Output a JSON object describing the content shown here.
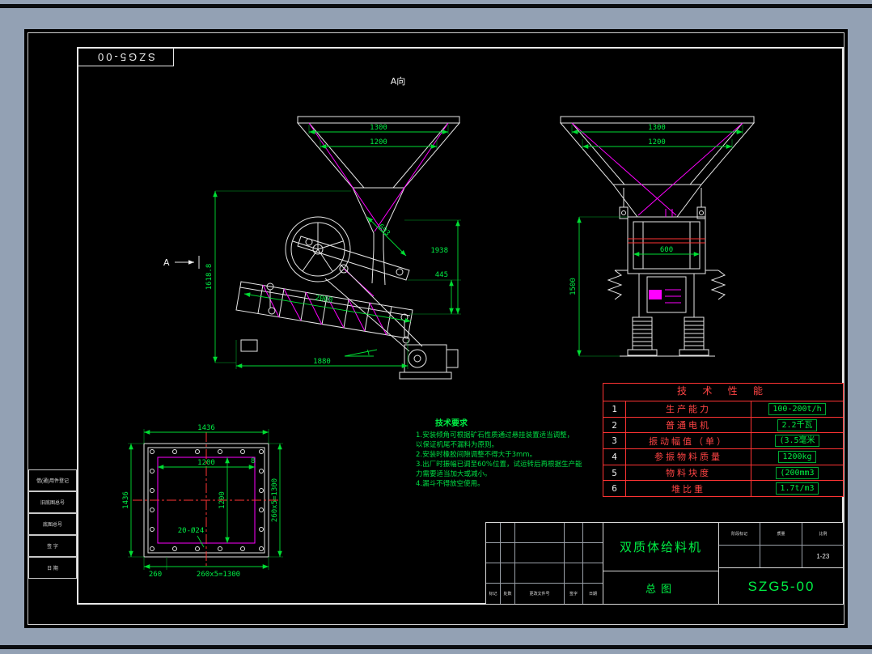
{
  "corner": {
    "drawing_no": "SZG5-00"
  },
  "labels": {
    "a_dir": "A向",
    "a_arrow": "A"
  },
  "front": {
    "dim_1300": "1300",
    "dim_1200": "1200",
    "dim_1618": "1618.8",
    "dim_1938": "1938",
    "dim_445": "445",
    "dim_693": "693",
    "dim_2000": "2000",
    "dim_1880": "1880"
  },
  "side": {
    "dim_1300": "1300",
    "dim_1200": "1200",
    "dim_1500": "1500",
    "dim_600": "600"
  },
  "plan": {
    "dim_top": "1436",
    "dim_left": "1436",
    "dim_1200h": "1200",
    "dim_1200v": "1200",
    "dim_8": "8",
    "dim_right": "260x5=1300",
    "dim_bottom": "260x5=1300",
    "dim_260": "260",
    "holes": "20-Ø24"
  },
  "notes": {
    "title": "技术要求",
    "lines": [
      "1.安装倾角可根据矿石性质通过悬挂装置适当调整，",
      "  以保证机尾不漏料为原则。",
      "2.安装时橡胶间隙调整不得大于3mm。",
      "3.出厂时振幅已调至60%位置，试运转后再根据生产能",
      "  力需要适当加大或减小。",
      "4.漏斗不得放空使用。"
    ]
  },
  "perf": {
    "title": "技 术 性 能",
    "rows": [
      {
        "no": "1",
        "name": "生产能力",
        "value": "100-200t/h"
      },
      {
        "no": "2",
        "name": "普通电机",
        "value": "2.2千瓦"
      },
      {
        "no": "3",
        "name": "振动幅值（单）",
        "value": "(3.5毫米"
      },
      {
        "no": "4",
        "name": "参振物料质量",
        "value": "1200kg"
      },
      {
        "no": "5",
        "name": "物料块度",
        "value": "(200mm3"
      },
      {
        "no": "6",
        "name": "堆比重",
        "value": "1.7t/m3"
      }
    ]
  },
  "titleblock": {
    "product": "双质体给料机",
    "sheet_name": "总图",
    "drawing_no": "SZG5-00",
    "scale": "1-23",
    "rev_labels": [
      "标记",
      "处数",
      "更改文件号",
      "签字",
      "日期"
    ],
    "stage_labels": [
      "阶段标记",
      "质量",
      "比例"
    ]
  },
  "left_blocks": [
    "借(通)用件登记",
    "旧底图总号",
    "底图总号",
    "签 字",
    "日 期"
  ]
}
